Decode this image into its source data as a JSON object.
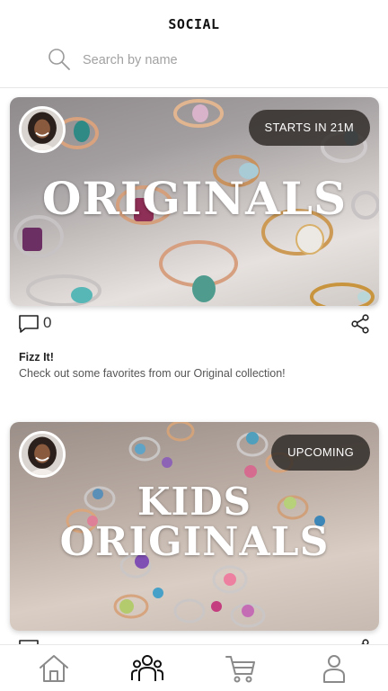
{
  "header": {
    "title": "SOCIAL",
    "search": {
      "placeholder": "Search by name",
      "value": "",
      "icon": "search-icon"
    }
  },
  "posts": [
    {
      "badge": "STARTS IN 21M",
      "overlay_lines": [
        "ORIGINALS"
      ],
      "comment_count": "0",
      "title": "Fizz It!",
      "description": "Check out some favorites from our Original collection!"
    },
    {
      "badge": "UPCOMING",
      "overlay_lines": [
        "KIDS",
        "ORIGINALS"
      ]
    }
  ],
  "tabbar": {
    "items": [
      {
        "icon": "home-icon",
        "active": false
      },
      {
        "icon": "people-icon",
        "active": true
      },
      {
        "icon": "cart-icon",
        "active": false
      },
      {
        "icon": "profile-icon",
        "active": false
      }
    ]
  },
  "colors": {
    "badge_bg": "#322d2a",
    "icon_inactive": "#8a8a8a",
    "icon_active": "#111111"
  }
}
